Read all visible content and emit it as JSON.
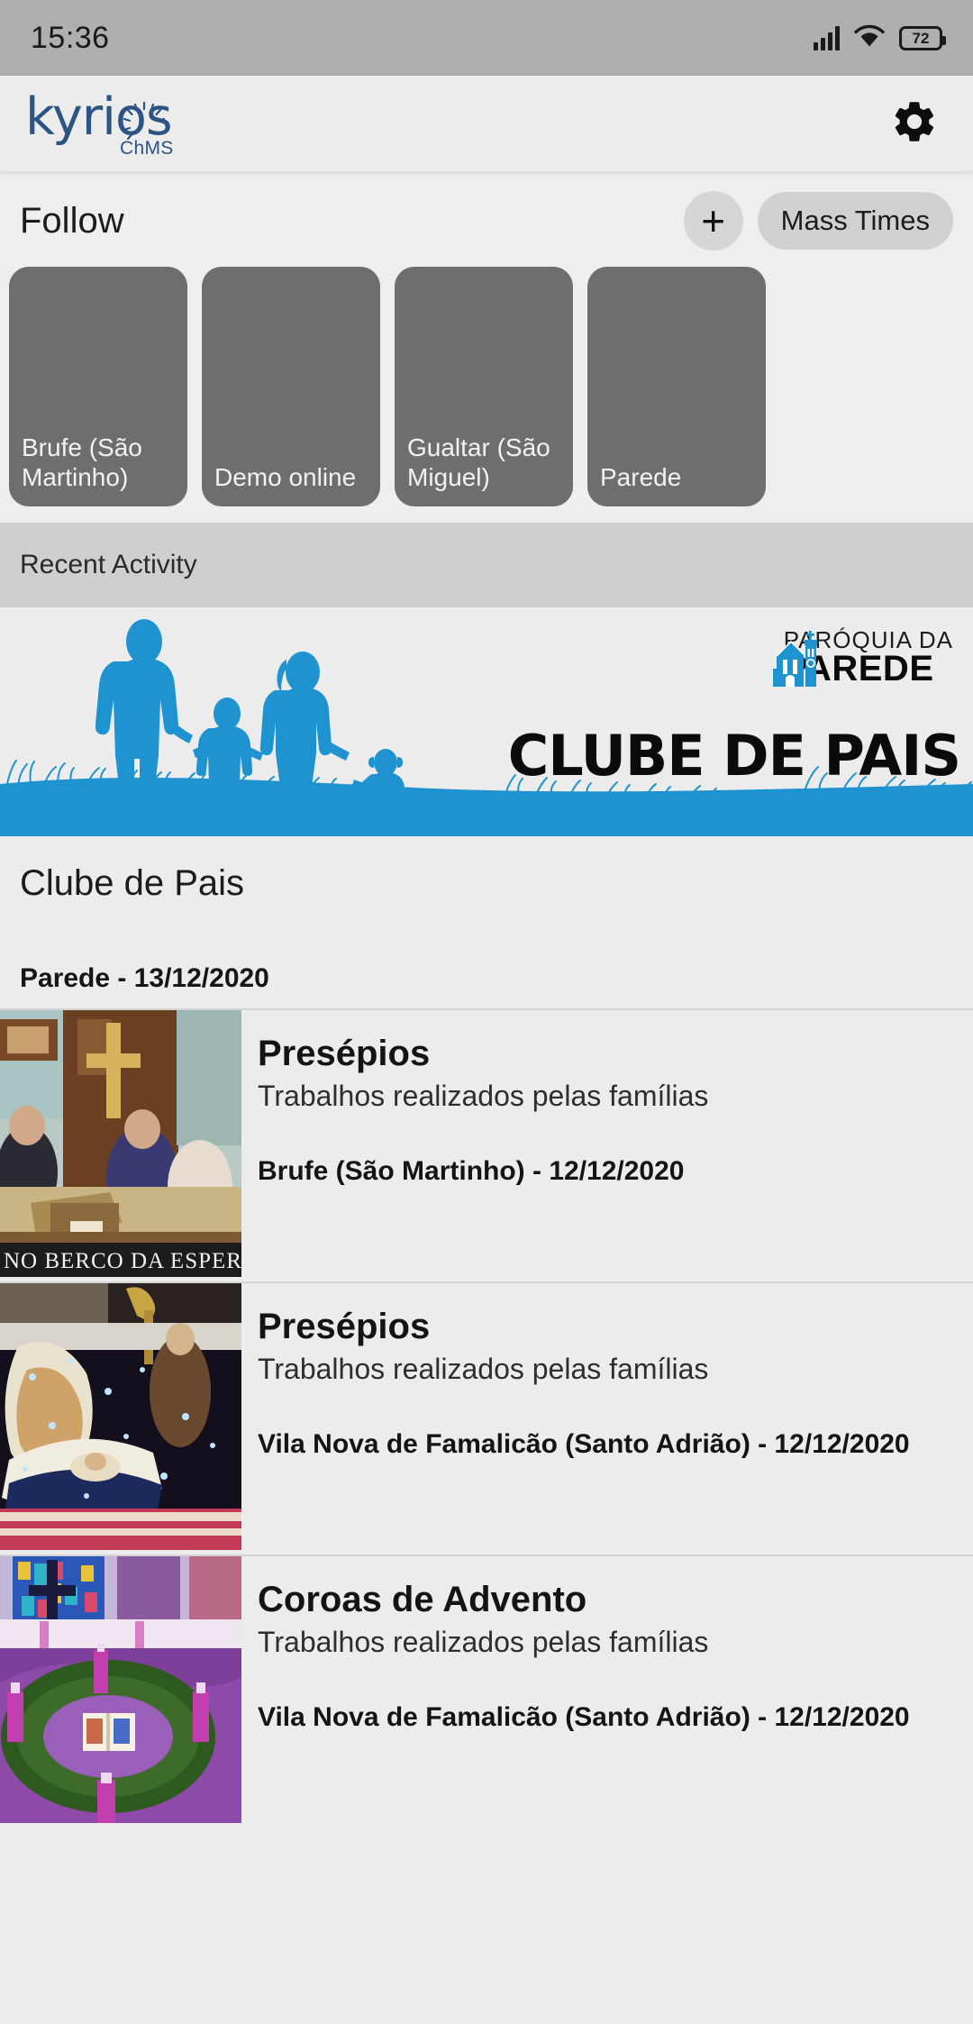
{
  "status_bar": {
    "time": "15:36",
    "battery_level": "72",
    "icons": [
      "signal-icon",
      "wifi-icon",
      "battery-icon"
    ]
  },
  "app_bar": {
    "logo_word": "kyrios",
    "logo_subtitle": "ChMS",
    "logo_color": "#2c5584",
    "settings_icon": "gear-icon"
  },
  "follow": {
    "title": "Follow",
    "add_label": "+",
    "mass_times_label": "Mass Times",
    "cards": [
      {
        "label": "Brufe (São Martinho)"
      },
      {
        "label": "Demo online"
      },
      {
        "label": "Gualtar (São Miguel)"
      },
      {
        "label": "Parede"
      }
    ]
  },
  "recent_activity": {
    "title": "Recent Activity"
  },
  "banner": {
    "title": "CLUBE DE PAIS",
    "parish_logo_line1": "PARÓQUIA DA",
    "parish_logo_line2": "PAREDE",
    "accent_color": "#1f93d0",
    "illustration": "family-silhouette"
  },
  "article": {
    "title": "Clube de Pais",
    "meta": "Parede - 13/12/2020"
  },
  "activity_list": [
    {
      "title": "Presépios",
      "subtitle": "Trabalhos realizados pelas famílias",
      "meta": "Brufe (São Martinho) - 12/12/2020",
      "thumbnail": "nativity-scene-church-photo",
      "caption": "NO BERCO DA ESPER"
    },
    {
      "title": "Presépios",
      "subtitle": "Trabalhos realizados pelas famílias",
      "meta": "Vila Nova de Famalicão (Santo Adrião) - 12/12/2020",
      "thumbnail": "nativity-crib-lights-photo"
    },
    {
      "title": "Coroas de Advento",
      "subtitle": "Trabalhos realizados pelas famílias",
      "meta": "Vila Nova de Famalicão (Santo Adrião) - 12/12/2020",
      "thumbnail": "advent-wreath-photo"
    }
  ]
}
